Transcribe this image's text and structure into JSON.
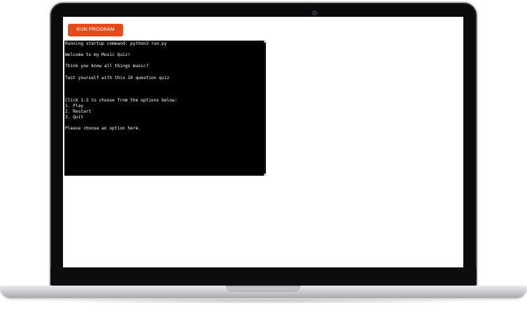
{
  "app": {
    "run_button_label": "RUN PROGRAM"
  },
  "terminal": {
    "lines": [
      "Running startup command: python3 run.py",
      "",
      "Welcome to my Music Quiz!",
      "",
      "Think you know all things music?",
      "",
      "Test yourself with this 10 question quiz",
      "",
      "",
      "",
      "Click 1-3 to choose from the options below:",
      "1. Play",
      "2. Restart",
      "3. Quit",
      "",
      "Please choose an option here."
    ]
  },
  "colors": {
    "accent": "#e64a19",
    "terminal_bg": "#000000",
    "terminal_text": "#ffffff"
  },
  "icons": {
    "camera": "webcam-icon"
  }
}
